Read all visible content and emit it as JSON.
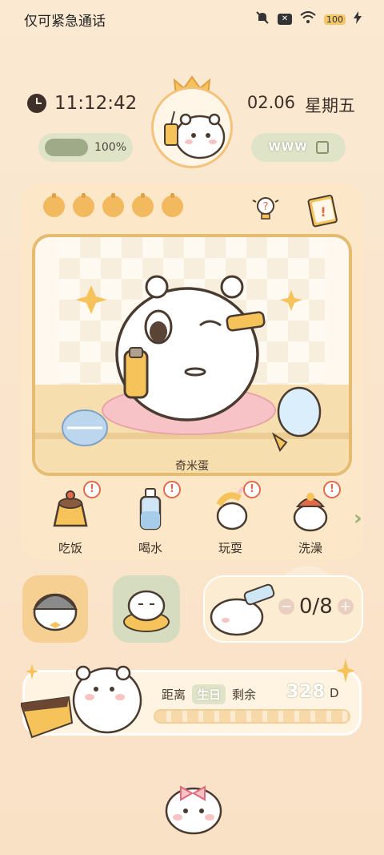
{
  "status_bar": {
    "left_text": "仅可紧急通话",
    "battery": "100"
  },
  "header": {
    "time": "11:12:42",
    "date": "02.06",
    "weekday": "星期五"
  },
  "battery_pill": {
    "percent_label": "100%",
    "level": 1.0
  },
  "wifi_pill": {
    "label": "WWW"
  },
  "pet": {
    "name": "奇米蛋"
  },
  "actions": [
    {
      "label": "吃饭",
      "badge": "!"
    },
    {
      "label": "喝水",
      "badge": "!"
    },
    {
      "label": "玩耍",
      "badge": "!"
    },
    {
      "label": "洗澡",
      "badge": "!"
    }
  ],
  "water_counter": {
    "value": "0/8",
    "minus": "−",
    "plus": "+"
  },
  "birthday": {
    "prefix": "距离",
    "highlight": "生日",
    "suffix": "剩余",
    "days": "328",
    "unit": "D"
  },
  "colors": {
    "background": "#fbe9d2",
    "card": "#fce8c8",
    "accent": "#f2b95f",
    "sage": "#dfe3c8",
    "alert": "#e16a4a"
  }
}
